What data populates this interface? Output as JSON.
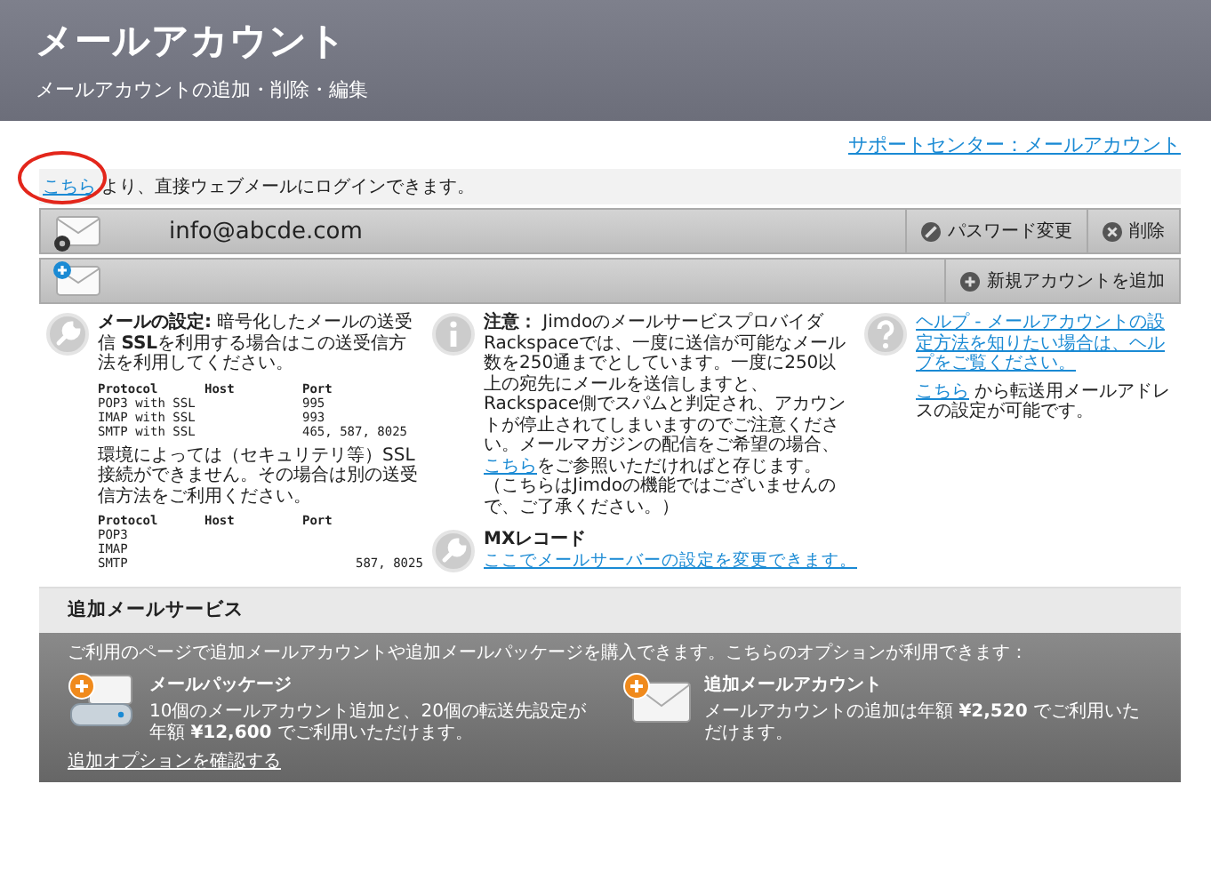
{
  "header": {
    "title": "メールアカウント",
    "subtitle": "メールアカウントの追加・削除・編集"
  },
  "support_link": "サポートセンター：メールアカウント",
  "login_note": {
    "link": "こちら",
    "text": "より、直接ウェブメールにログインできます。",
    "circled": true
  },
  "account": {
    "email": "info@abcde.com",
    "actions": [
      {
        "kind": "edit",
        "label": "パスワード変更"
      },
      {
        "kind": "delete",
        "label": "削除"
      }
    ]
  },
  "new_account": {
    "label": "新規アカウントを追加"
  },
  "settings": {
    "text": "**メールの設定:** 暗号化したメールの送受信 **SSL**を利用する場合はこの送受信方法を利用してください。",
    "tables": [
      {
        "columns": [
          "Protocol",
          "Host",
          "Port"
        ],
        "rows": [
          {
            "protocol": "POP3 with SSL",
            "port": "995"
          },
          {
            "protocol": "IMAP with SSL",
            "port": "993"
          },
          {
            "protocol": "SMTP with SSL",
            "port": "465, 587, 8025"
          }
        ]
      },
      {
        "columns": [
          "Protocol",
          "Host",
          "Port"
        ],
        "rows": [
          {
            "protocol": "POP3"
          },
          {
            "protocol": "IMAP"
          },
          {
            "protocol": "SMTP",
            "port": "587, 8025"
          }
        ]
      }
    ],
    "note": "環境によっては（セキュリテリ等）SSL接続ができません。その場合は別の送受信方法をご利用ください。"
  },
  "notice": {
    "before": "**注意：** Jimdoのメールサービスプロバイダ Rackspaceでは、一度に送信が可能なメール数を250通までとしています。一度に250以上の宛先にメールを送信しますと、Rackspace側でスパムと判定され、アカウントが停止されてしまいますのでご注意ください。メールマガジンの配信をご希望の場合、",
    "link": "こちら",
    "after": "をご参照いただければと存じます。（こちらはJimdoの機能ではございませんので、ご了承ください。）"
  },
  "mx": {
    "title": "MXレコード",
    "link": "ここでメールサーバーの設定を変更できます。"
  },
  "help": {
    "link": "ヘルプ - メールアカウントの設定方法を知りたい場合は、ヘルプをご覧ください。",
    "forward_link": "こちら",
    "forward_text": "から転送用メールアドレスの設定が可能です。"
  },
  "services": {
    "title": "追加メールサービス",
    "intro": "ご利用のページで追加メールアカウントや追加メールパッケージを購入できます。こちらのオプションが利用できます：",
    "items": [
      {
        "kind": "package",
        "title": "メールパッケージ",
        "text": "10個のメールアカウント追加と、20個の転送先設定が年額 **¥12,600** でご利用いただけます。"
      },
      {
        "kind": "account",
        "title": "追加メールアカウント",
        "text": "メールアカウントの追加は年額 **¥2,520** でご利用いただけます。"
      }
    ],
    "link": "追加オプションを確認する"
  }
}
